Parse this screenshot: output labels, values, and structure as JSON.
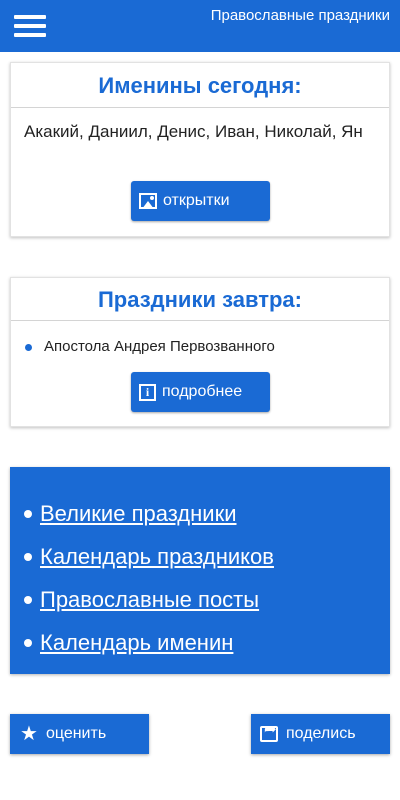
{
  "app": {
    "title": "Православные праздники"
  },
  "namedays": {
    "title": "Именины сегодня:",
    "names": "Акакий, Даниил, Денис, Иван, Николай, Ян",
    "button_label": "открытки"
  },
  "holidays": {
    "title": "Праздники завтра:",
    "items": [
      "Апостола Андрея Первозванного"
    ],
    "button_label": "подробнее"
  },
  "links": [
    {
      "label": "Великие праздники"
    },
    {
      "label": "Календарь праздников"
    },
    {
      "label": "Православные посты"
    },
    {
      "label": "Календарь именин"
    }
  ],
  "footer": {
    "rate_label": "оценить",
    "share_label": "поделись"
  },
  "colors": {
    "accent": "#1a6ad4",
    "background": "#ffffff"
  },
  "icons": [
    "menu-icon",
    "image-icon",
    "info-icon",
    "star-icon",
    "share-icon"
  ]
}
